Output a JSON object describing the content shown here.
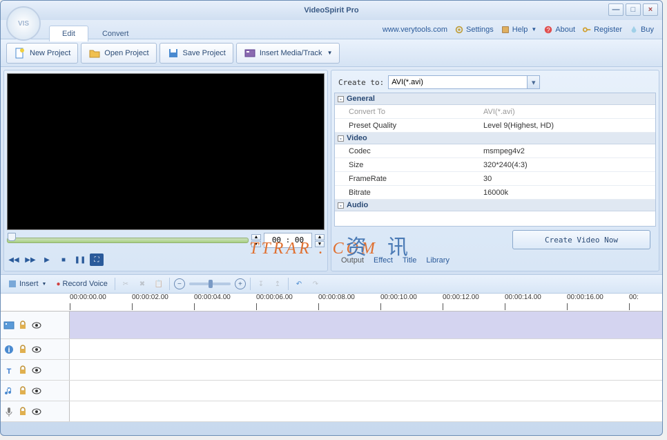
{
  "app": {
    "title": "VideoSpirit Pro",
    "logo": "VIS"
  },
  "window_controls": {
    "min": "—",
    "max": "□",
    "close": "×"
  },
  "tabs": {
    "edit": "Edit",
    "convert": "Convert"
  },
  "menubar": {
    "website": "www.verytools.com",
    "settings": "Settings",
    "help": "Help",
    "about": "About",
    "register": "Register",
    "buy": "Buy"
  },
  "toolbar": {
    "new_project": "New Project",
    "open_project": "Open Project",
    "save_project": "Save Project",
    "insert_media": "Insert Media/Track"
  },
  "preview": {
    "time": "00 : 00"
  },
  "output": {
    "create_to_label": "Create to:",
    "format_selected": "AVI(*.avi)",
    "sections": {
      "general": "General",
      "video": "Video",
      "audio": "Audio"
    },
    "props": {
      "convert_to_k": "Convert To",
      "convert_to_v": "AVI(*.avi)",
      "preset_k": "Preset Quality",
      "preset_v": "Level 9(Highest, HD)",
      "codec_k": "Codec",
      "codec_v": "msmpeg4v2",
      "size_k": "Size",
      "size_v": "320*240(4:3)",
      "framerate_k": "FrameRate",
      "framerate_v": "30",
      "bitrate_k": "Bitrate",
      "bitrate_v": "16000k"
    },
    "create_btn": "Create Video Now",
    "tabs": {
      "output": "Output",
      "effect": "Effect",
      "title": "Title",
      "library": "Library"
    }
  },
  "timeline_toolbar": {
    "insert": "Insert",
    "record_voice": "Record Voice"
  },
  "ruler": [
    "00:00:00.00",
    "00:00:02.00",
    "00:00:04.00",
    "00:00:06.00",
    "00:00:08.00",
    "00:00:10.00",
    "00:00:12.00",
    "00:00:14.00",
    "00:00:16.00",
    "00:"
  ],
  "watermark": {
    "text1": "TTRAR . COM",
    "text2": "资　讯"
  }
}
